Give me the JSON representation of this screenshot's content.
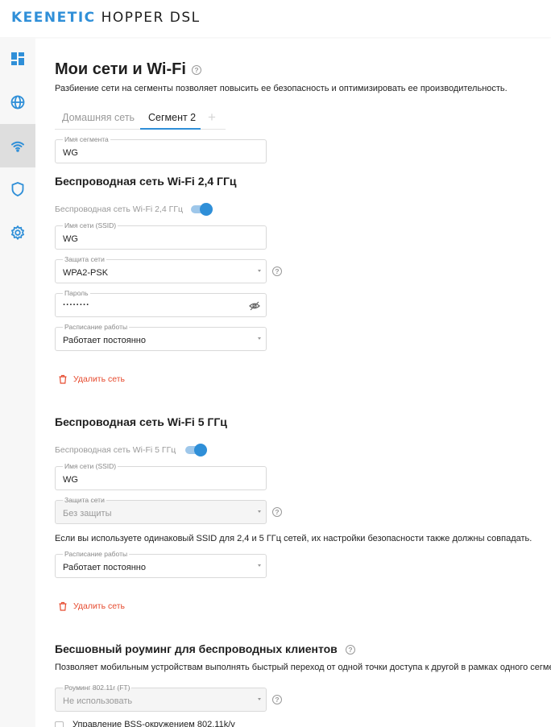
{
  "brand": {
    "name": "KEENETIC",
    "model": "HOPPER DSL",
    "color": "#2f8fd8"
  },
  "sidebar": {
    "items": [
      {
        "icon": "dashboard-icon",
        "active": false
      },
      {
        "icon": "globe-icon",
        "active": false
      },
      {
        "icon": "wifi-icon",
        "active": true
      },
      {
        "icon": "shield-icon",
        "active": false
      },
      {
        "icon": "gear-icon",
        "active": false
      }
    ]
  },
  "page": {
    "title": "Мои сети и Wi-Fi",
    "description": "Разбиение сети на сегменты позволяет повысить ее безопасность и оптимизировать ее производительность."
  },
  "tabs": [
    {
      "label": "Домашняя сеть",
      "active": false
    },
    {
      "label": "Сегмент 2",
      "active": true
    }
  ],
  "tab_add": "+",
  "segment": {
    "label": "Имя сегмента",
    "value": "WG"
  },
  "wifi24": {
    "title": "Беспроводная сеть Wi-Fi 2,4 ГГц",
    "toggle_label": "Беспроводная сеть Wi-Fi 2,4 ГГц",
    "enabled": true,
    "ssid": {
      "label": "Имя сети (SSID)",
      "value": "WG"
    },
    "security": {
      "label": "Защита сети",
      "value": "WPA2-PSK"
    },
    "password": {
      "label": "Пароль",
      "value": "········"
    },
    "schedule": {
      "label": "Расписание работы",
      "value": "Работает постоянно"
    },
    "delete_label": "Удалить сеть"
  },
  "wifi5": {
    "title": "Беспроводная сеть Wi-Fi 5 ГГц",
    "toggle_label": "Беспроводная сеть Wi-Fi 5 ГГц",
    "enabled": true,
    "ssid": {
      "label": "Имя сети (SSID)",
      "value": "WG"
    },
    "security": {
      "label": "Защита сети",
      "value": "Без защиты"
    },
    "note": "Если вы используете одинаковый SSID для 2,4 и 5 ГГц сетей, их настройки безопасности также должны совпадать.",
    "schedule": {
      "label": "Расписание работы",
      "value": "Работает постоянно"
    },
    "delete_label": "Удалить сеть"
  },
  "roaming": {
    "title": "Бесшовный роуминг для беспроводных клиентов",
    "description": "Позволяет мобильным устройствам выполнять быстрый переход от одной точки доступа к другой в рамках одного сегмента",
    "ft": {
      "label": "Роуминг 802.11r (FT)",
      "value": "Не использовать"
    },
    "bss_label": "Управление BSS-окружением 802.11k/v"
  },
  "colors": {
    "accent": "#2f8fd8",
    "danger": "#e64a2e",
    "muted": "#9a9a9a"
  }
}
